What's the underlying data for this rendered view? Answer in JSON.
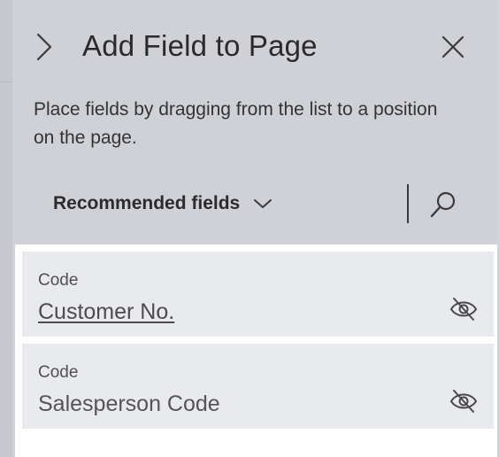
{
  "header": {
    "title": "Add Field to Page",
    "collapse_icon": "chevron-right-icon",
    "close_icon": "close-icon"
  },
  "description": "Place fields by dragging from the list to a position on the page.",
  "filter": {
    "label": "Recommended fields",
    "icon": "chevron-down-icon",
    "search_icon": "search-icon"
  },
  "fields": [
    {
      "caption": "Code",
      "name": "Customer No.",
      "underlined": true,
      "icon": "eye-hidden-icon"
    },
    {
      "caption": "Code",
      "name": "Salesperson Code",
      "underlined": false,
      "icon": "eye-hidden-icon"
    }
  ],
  "colors": {
    "panel_bg": "#cfd1d6",
    "card_bg": "#e9eaed",
    "text": "#2a2a2a"
  }
}
